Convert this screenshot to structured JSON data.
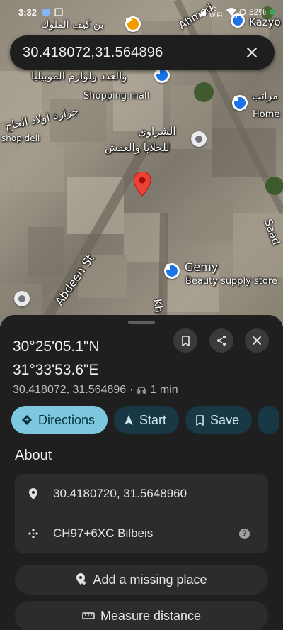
{
  "status_bar": {
    "time": "3:32",
    "signal": "Vo WiFi",
    "battery": "52%"
  },
  "search": {
    "query": "30.418072,31.564896"
  },
  "map": {
    "labels": {
      "cafe": "بن كيف الملوك",
      "street_top": "Ahmed",
      "kazyo": "Kazyo",
      "shop_name_ar": "والعدد ولوازم الموبيليا",
      "shop_type": "Shopping mall",
      "butcher_ar": "جزارة اولاد الحاج",
      "shop_deli": "shop deli",
      "marat_ar": "مراتب",
      "home": "Home",
      "sharawy_ar_1": "الشراوي",
      "sharawy_ar_2": "للحلايا والعفش",
      "gemy": "Gemy",
      "gemy_type": "Beauty supply store",
      "abdeen": "Abdeen St",
      "saad": "Saad",
      "kh": "Kh"
    },
    "colors": {
      "pin_red": "#ea4335",
      "poi_blue": "#1a73e8",
      "cafe_orange": "#f29900"
    }
  },
  "place": {
    "lat_dms": "30°25'05.1\"N",
    "lng_dms": "31°33'53.6\"E",
    "coords_short": "30.418072, 31.564896",
    "separator": "·",
    "drive_time": "1 min"
  },
  "actions": {
    "directions": "Directions",
    "start": "Start",
    "save": "Save"
  },
  "about": {
    "heading": "About",
    "coordinates": "30.4180720, 31.5648960",
    "plus_code": "CH97+6XC Bilbeis",
    "help": "?"
  },
  "buttons": {
    "add_place": "Add a missing place",
    "measure": "Measure distance"
  }
}
